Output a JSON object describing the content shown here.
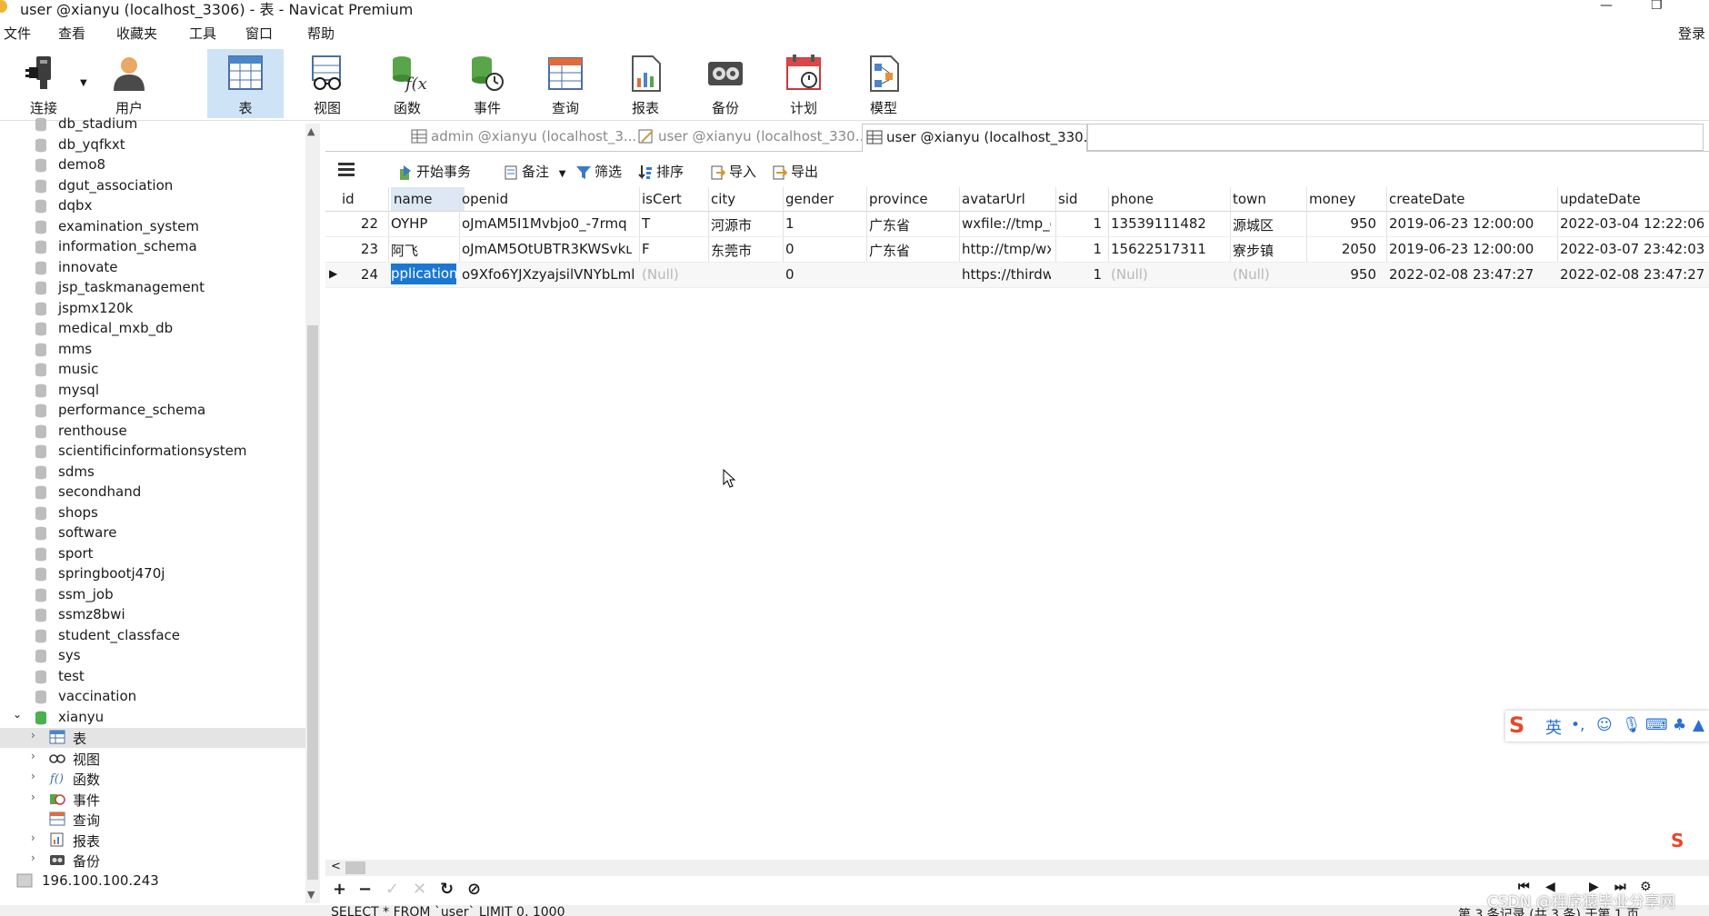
{
  "window": {
    "title": "user @xianyu (localhost_3306) - 表 - Navicat Premium",
    "minimize": "—",
    "restore": "❐"
  },
  "menu": {
    "items": [
      "文件",
      "查看",
      "收藏夹",
      "工具",
      "窗口",
      "帮助"
    ],
    "login": "登录"
  },
  "toolbar": {
    "buttons": [
      {
        "label": "连接",
        "icon": "plug-icon"
      },
      {
        "label": "用户",
        "icon": "user-icon"
      },
      {
        "label": "表",
        "icon": "table-icon",
        "active": true
      },
      {
        "label": "视图",
        "icon": "view-icon"
      },
      {
        "label": "函数",
        "icon": "function-icon"
      },
      {
        "label": "事件",
        "icon": "event-icon"
      },
      {
        "label": "查询",
        "icon": "query-icon"
      },
      {
        "label": "报表",
        "icon": "report-icon"
      },
      {
        "label": "备份",
        "icon": "backup-icon"
      },
      {
        "label": "计划",
        "icon": "schedule-icon"
      },
      {
        "label": "模型",
        "icon": "model-icon"
      }
    ]
  },
  "sidebar": {
    "databases": [
      "db_stadium",
      "db_yqfkxt",
      "demo8",
      "dgut_association",
      "dqbx",
      "examination_system",
      "information_schema",
      "innovate",
      "jsp_taskmanagement",
      "jspmx120k",
      "medical_mxb_db",
      "mms",
      "music",
      "mysql",
      "performance_schema",
      "renthouse",
      "scientificinformationsystem",
      "sdms",
      "secondhand",
      "shops",
      "software",
      "sport",
      "springbootj470j",
      "ssm_job",
      "ssmz8bwi",
      "student_classface",
      "sys",
      "test",
      "vaccination"
    ],
    "open_db": "xianyu",
    "children": [
      {
        "label": "表",
        "icon": "table-icon",
        "expandable": true,
        "selected": true
      },
      {
        "label": "视图",
        "icon": "view-icon",
        "expandable": true
      },
      {
        "label": "函数",
        "icon": "function-icon",
        "expandable": true
      },
      {
        "label": "事件",
        "icon": "event-icon",
        "expandable": true
      },
      {
        "label": "查询",
        "icon": "query-icon",
        "expandable": false
      },
      {
        "label": "报表",
        "icon": "report-icon",
        "expandable": true
      },
      {
        "label": "备份",
        "icon": "backup-icon",
        "expandable": true
      }
    ],
    "connection": "196.100.100.243"
  },
  "tabs": [
    {
      "label": "admin @xianyu (localhost_3...",
      "active": false,
      "icon": "table-icon"
    },
    {
      "label": "user @xianyu (localhost_330...",
      "active": false,
      "icon": "design-table-icon"
    },
    {
      "label": "user @xianyu (localhost_330...",
      "active": true,
      "icon": "table-icon"
    }
  ],
  "grid_toolbar": {
    "begin_transaction": "开始事务",
    "note": "备注",
    "filter": "筛选",
    "sort": "排序",
    "import": "导入",
    "export": "导出"
  },
  "table": {
    "columns": [
      "id",
      "name",
      "openid",
      "isCert",
      "city",
      "gender",
      "province",
      "avatarUrl",
      "sid",
      "phone",
      "town",
      "money",
      "createDate",
      "updateDate"
    ],
    "rows": [
      [
        "22",
        "OYHP",
        "oJmAM5I1Mvbjo0_-7rmq",
        "T",
        "河源市",
        "1",
        "广东省",
        "wxfile://tmp_e",
        "1",
        "13539111482",
        "源城区",
        "950",
        "2019-06-23 12:00:00",
        "2022-03-04 12:22:06"
      ],
      [
        "23",
        "阿飞",
        "oJmAM5OtUBTR3KWSvkւ",
        "F",
        "东莞市",
        "0",
        "广东省",
        "http://tmp/wx",
        "1",
        "15622517311",
        "寮步镇",
        "2050",
        "2019-06-23 12:00:00",
        "2022-03-07 23:42:03"
      ],
      [
        "24",
        "pplication",
        "o9Xfo6YJXzyajsilVNYbLml",
        "(Null)",
        "",
        "0",
        "",
        "https://thirdw",
        "1",
        "(Null)",
        "(Null)",
        "950",
        "2022-02-08 23:47:27",
        "2022-02-08 23:47:27"
      ]
    ]
  },
  "status": {
    "sql": "SELECT * FROM `user` LIMIT 0, 1000",
    "records": "第 3 条记录 (共 3 条) 于第 1 页"
  },
  "watermark": "CSDN @程序猿毕业分享网",
  "ime": {
    "logo": "S",
    "lang": "英"
  }
}
